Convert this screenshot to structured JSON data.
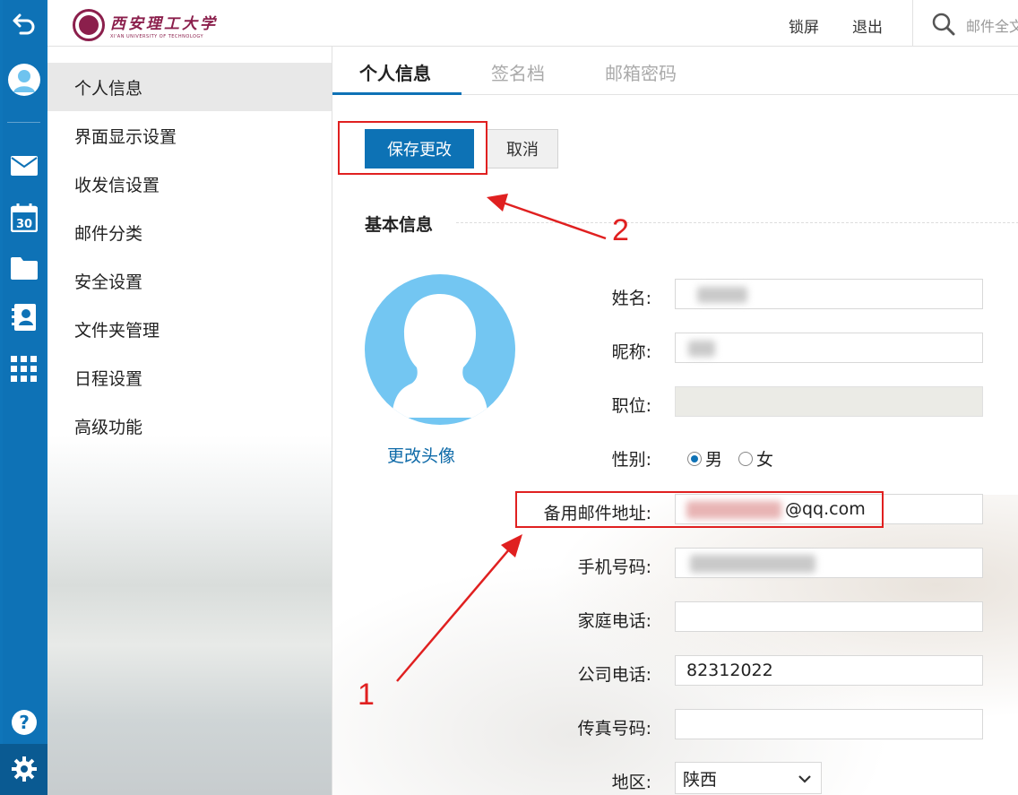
{
  "topbar": {
    "logo_cn": "西安理工大学",
    "logo_en": "XI'AN UNIVERSITY OF TECHNOLOGY",
    "lock_label": "锁屏",
    "logout_label": "退出",
    "search_placeholder": "邮件全文"
  },
  "rail": {
    "icons": [
      "back-icon",
      "user-avatar-icon",
      "mail-icon",
      "calendar-icon",
      "folder-icon",
      "contacts-icon",
      "apps-grid-icon",
      "help-icon",
      "settings-gear-icon"
    ],
    "calendar_day": "30"
  },
  "subnav": {
    "items": [
      {
        "label": "个人信息",
        "active": true
      },
      {
        "label": "界面显示设置"
      },
      {
        "label": "收发信设置"
      },
      {
        "label": "邮件分类"
      },
      {
        "label": "安全设置"
      },
      {
        "label": "文件夹管理"
      },
      {
        "label": "日程设置"
      },
      {
        "label": "高级功能"
      }
    ]
  },
  "tabs": [
    {
      "label": "个人信息",
      "active": true
    },
    {
      "label": "签名档"
    },
    {
      "label": "邮箱密码"
    }
  ],
  "actions": {
    "save_label": "保存更改",
    "cancel_label": "取消"
  },
  "section": {
    "title": "基本信息"
  },
  "avatar": {
    "change_label": "更改头像"
  },
  "form": {
    "name_label": "姓名:",
    "nickname_label": "昵称:",
    "position_label": "职位:",
    "gender_label": "性别:",
    "gender_male": "男",
    "gender_female": "女",
    "backup_email_label": "备用邮件地址:",
    "backup_email_suffix": "@qq.com",
    "mobile_label": "手机号码:",
    "home_phone_label": "家庭电话:",
    "office_phone_label": "公司电话:",
    "office_phone_value": "82312022",
    "fax_label": "传真号码:",
    "region_label": "地区:",
    "region_value": "陕西"
  },
  "annotations": {
    "one": "1",
    "two": "2"
  },
  "colors": {
    "rail_blue": "#0e72b6",
    "primary_button": "#0d72b5",
    "avatar_blue": "#73c6f2",
    "annotation_red": "#e02020"
  }
}
